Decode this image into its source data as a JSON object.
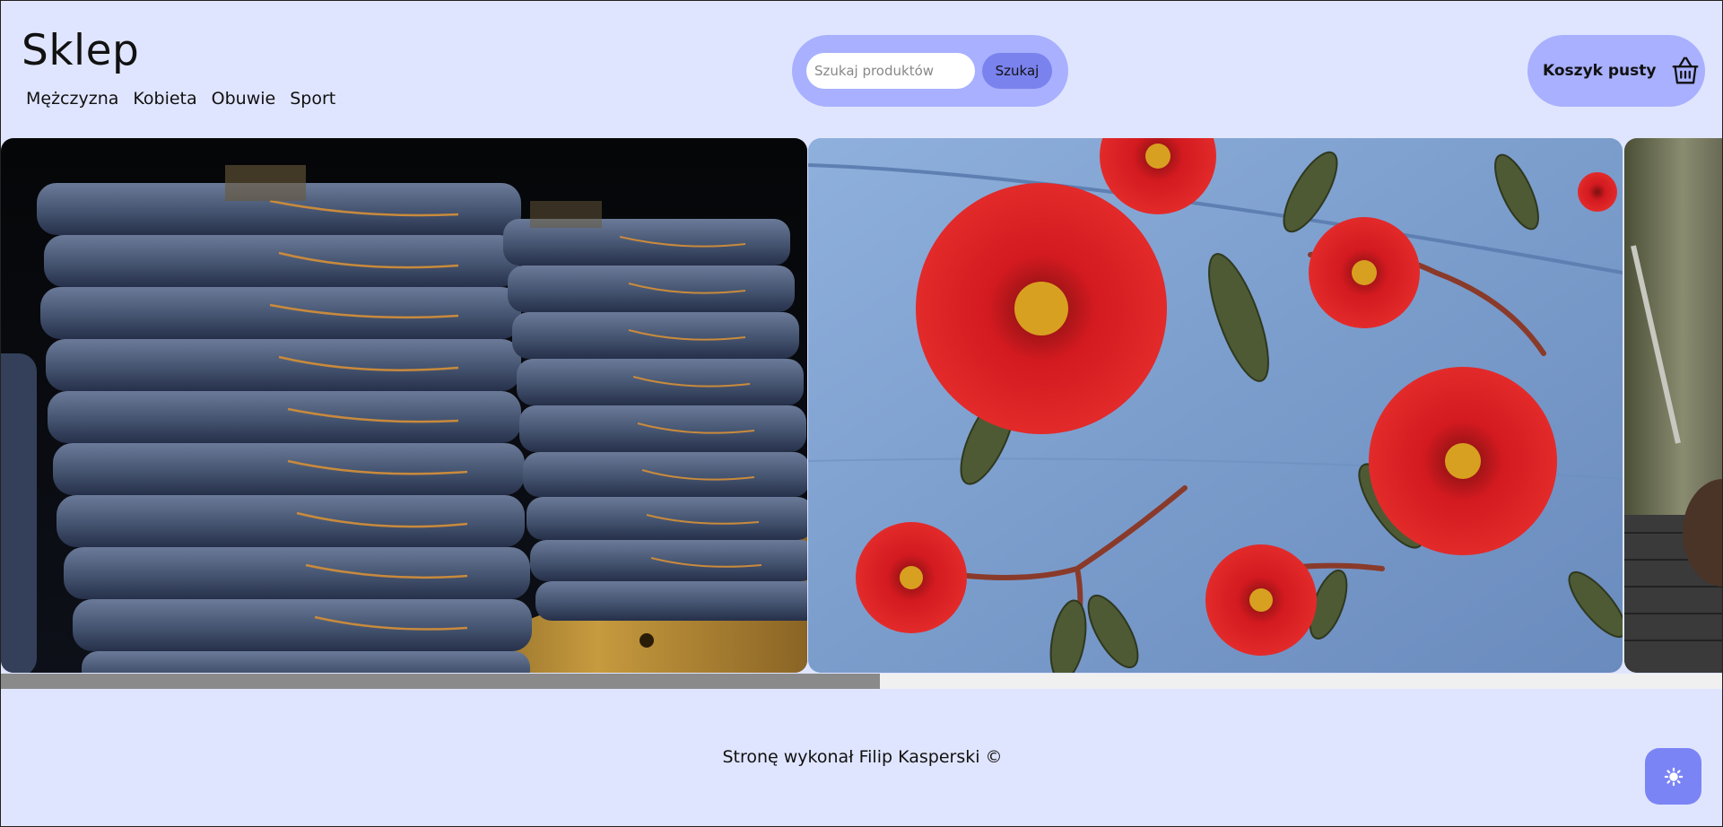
{
  "header": {
    "brand": "Sklep",
    "nav": [
      "Mężczyzna",
      "Kobieta",
      "Obuwie",
      "Sport"
    ],
    "search": {
      "placeholder": "Szukaj produktów",
      "value": "",
      "button_label": "Szukaj"
    },
    "cart": {
      "label": "Koszyk pusty",
      "icon": "basket-icon"
    }
  },
  "carousel": {
    "slides": [
      {
        "subject": "stacked folded jeans on shelf"
      },
      {
        "subject": "denim with embroidered red poppies"
      },
      {
        "subject": "partial vintage machine close-up"
      }
    ],
    "scroll_progress": 0.51
  },
  "footer": {
    "credit": "Stronę wykonał Filip Kasperski ©"
  },
  "theme_toggle": {
    "icon": "sun-icon"
  },
  "colors": {
    "background": "#e0e5ff",
    "pill": "#a8b0ff",
    "accent": "#7a82ee"
  }
}
